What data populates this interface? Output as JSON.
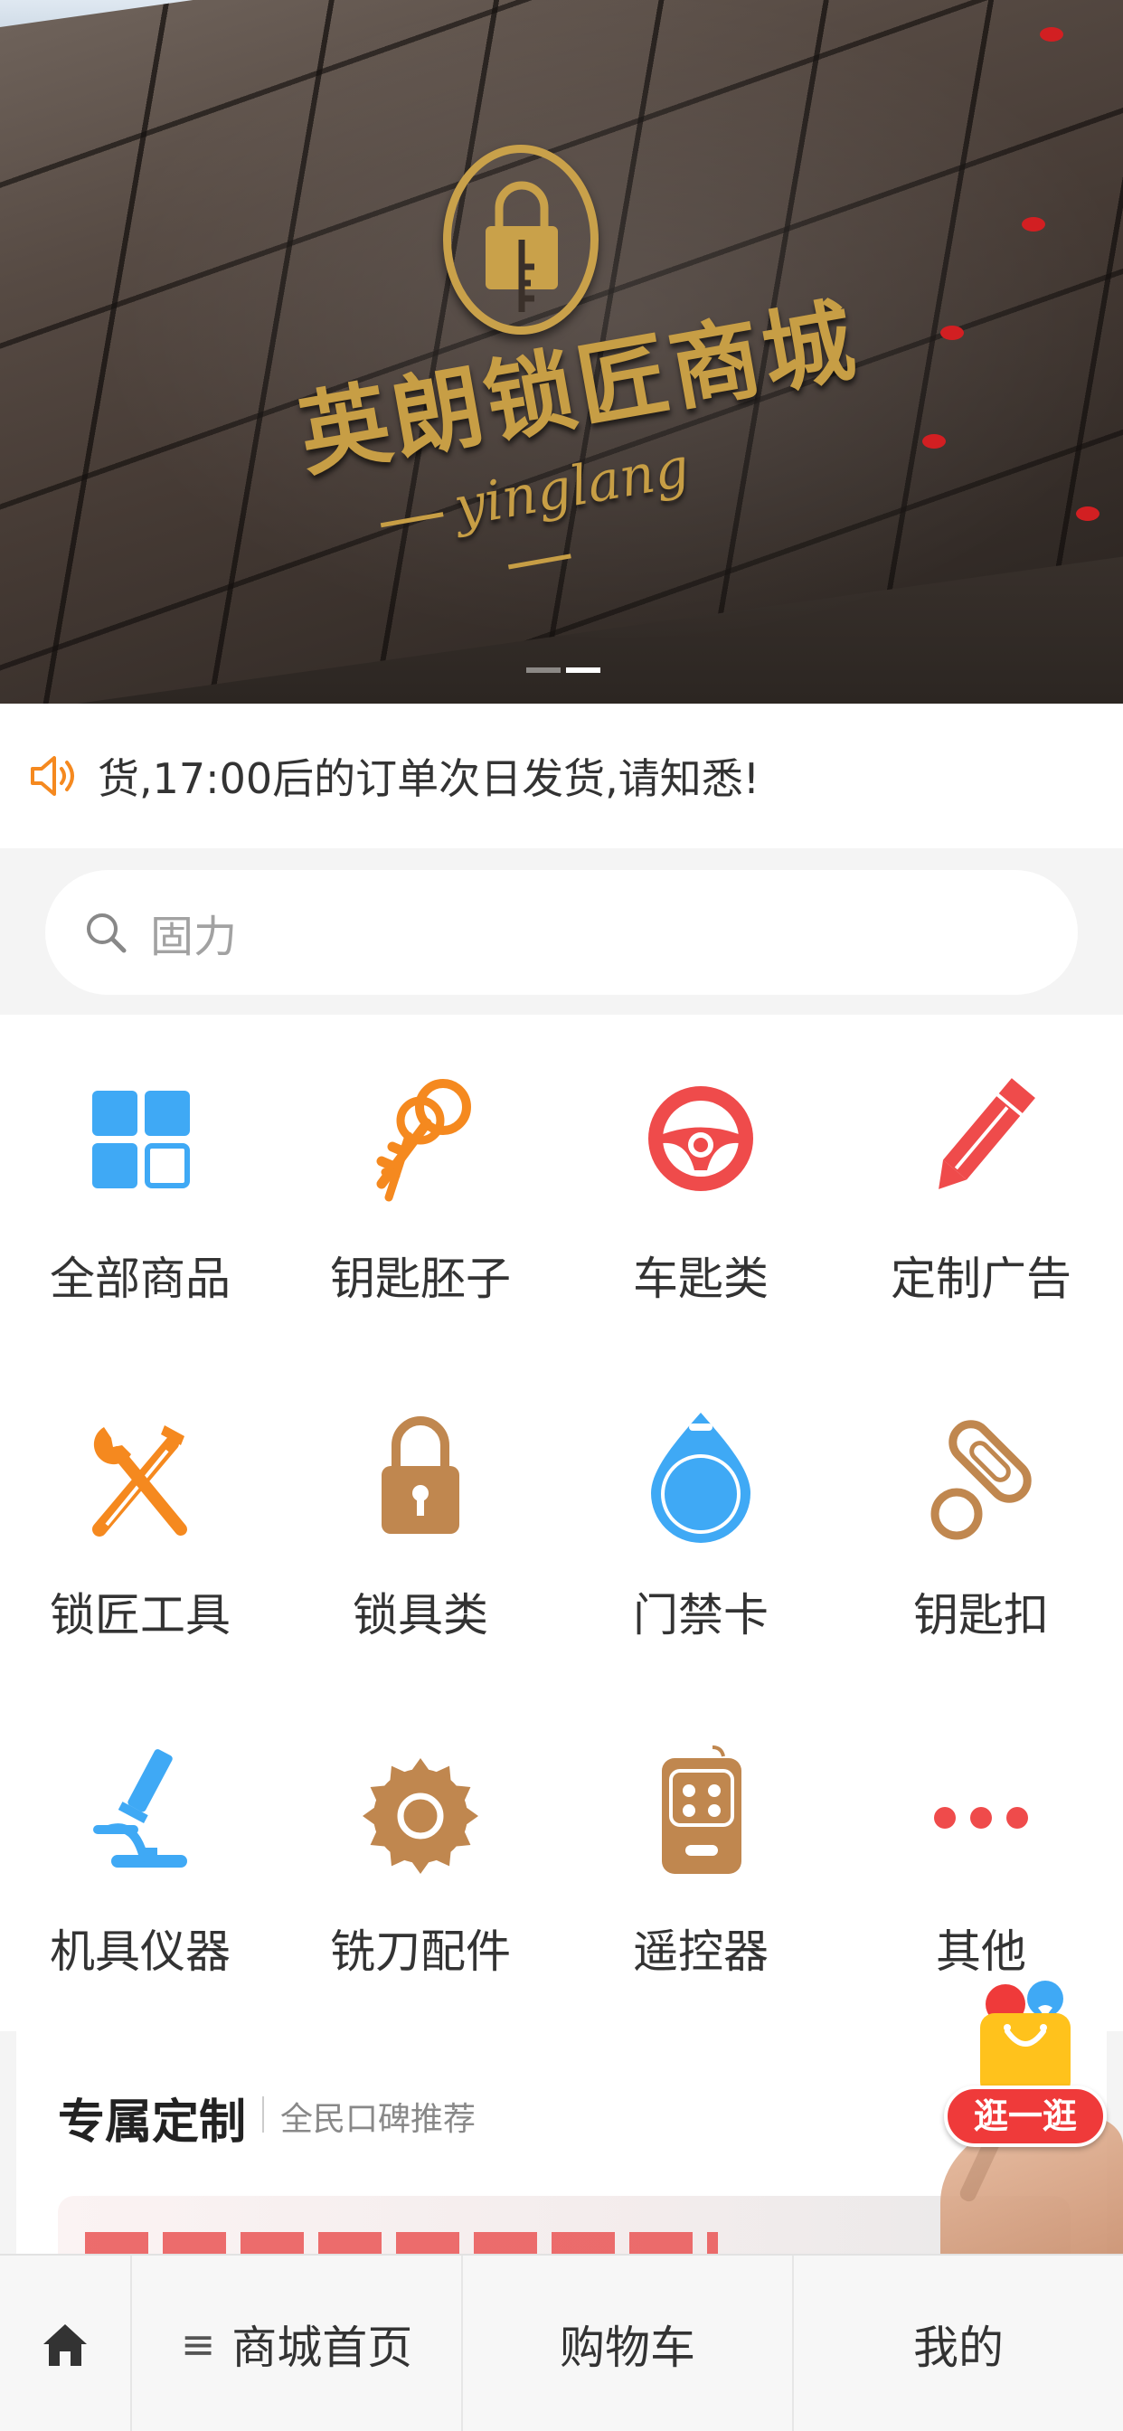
{
  "banner": {
    "brand_name": "英朗锁匠商城",
    "brand_sub": "yinglang",
    "slides": 2,
    "active_slide": 2
  },
  "notice": {
    "text": "货,17:00后的订单次日发货,请知悉!"
  },
  "search": {
    "placeholder": "固力"
  },
  "categories": [
    {
      "label": "全部商品",
      "icon": "grid-icon",
      "color": "#3fa9f5"
    },
    {
      "label": "钥匙胚子",
      "icon": "keys-icon",
      "color": "#f5891f"
    },
    {
      "label": "车匙类",
      "icon": "steering-wheel-icon",
      "color": "#ef4b4b"
    },
    {
      "label": "定制广告",
      "icon": "pencil-icon",
      "color": "#ef4b4b"
    },
    {
      "label": "锁匠工具",
      "icon": "tools-icon",
      "color": "#f5891f"
    },
    {
      "label": "锁具类",
      "icon": "padlock-icon",
      "color": "#c0874f"
    },
    {
      "label": "门禁卡",
      "icon": "access-card-icon",
      "color": "#3fa9f5"
    },
    {
      "label": "钥匙扣",
      "icon": "keyring-icon",
      "color": "#c0874f"
    },
    {
      "label": "机具仪器",
      "icon": "microscope-icon",
      "color": "#3fa9f5"
    },
    {
      "label": "铣刀配件",
      "icon": "saw-blade-icon",
      "color": "#c0874f"
    },
    {
      "label": "遥控器",
      "icon": "remote-control-icon",
      "color": "#c0874f"
    },
    {
      "label": "其他",
      "icon": "more-dots-icon",
      "color": "#ef4b4b"
    }
  ],
  "section": {
    "title": "专属定制",
    "subtitle": "全民口碑推荐"
  },
  "floating": {
    "label": "逛一逛"
  },
  "tabbar": {
    "home_icon": "home-icon",
    "menu_icon": "menu-icon",
    "store": "商城首页",
    "cart": "购物车",
    "me": "我的"
  },
  "colors": {
    "accent_red": "#ef3a3a",
    "accent_orange": "#f5891f",
    "accent_blue": "#3fa9f5",
    "accent_brown": "#c0874f",
    "gold": "#c79e45"
  }
}
